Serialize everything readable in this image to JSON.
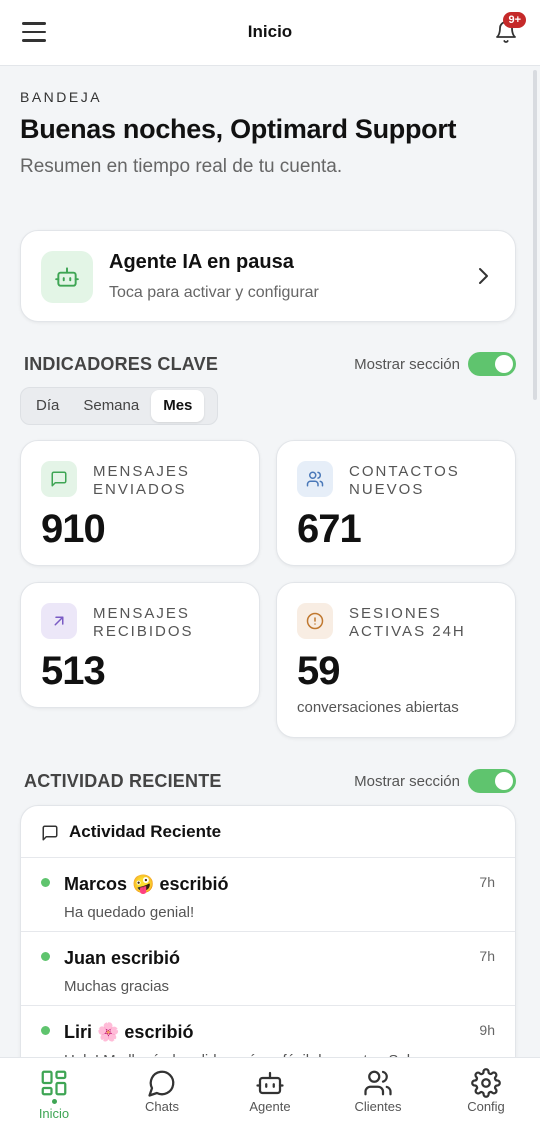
{
  "header": {
    "title": "Inicio",
    "notification_badge": "9+"
  },
  "intro": {
    "eyebrow": "BANDEJA",
    "greeting": "Buenas noches, Optimard Support",
    "subtitle": "Resumen en tiempo real de tu cuenta."
  },
  "agent_card": {
    "title": "Agente IA en pausa",
    "subtitle": "Toca para activar y configurar"
  },
  "kpi_section": {
    "title": "INDICADORES CLAVE",
    "toggle_label": "Mostrar sección",
    "toggle_on": true,
    "periods": [
      "Día",
      "Semana",
      "Mes"
    ],
    "selected_period": "Mes",
    "cards": [
      {
        "label": "MENSAJES ENVIADOS",
        "value": "910",
        "icon": "message-icon",
        "color": "#e4f4e7"
      },
      {
        "label": "CONTACTOS NUEVOS",
        "value": "671",
        "icon": "users-icon",
        "color": "#e6eef8"
      },
      {
        "label": "MENSAJES RECIBIDOS",
        "value": "513",
        "icon": "arrow-up-right-icon",
        "color": "#ece7f8"
      },
      {
        "label": "SESIONES ACTIVAS 24H",
        "value": "59",
        "note": "conversaciones abiertas",
        "icon": "alert-circle-icon",
        "color": "#f8ede3"
      }
    ]
  },
  "activity_section": {
    "title": "ACTIVIDAD RECIENTE",
    "toggle_label": "Mostrar sección",
    "toggle_on": true,
    "card_title": "Actividad Reciente",
    "items": [
      {
        "title": "Marcos 🤪 escribió",
        "message": "Ha quedado genial!",
        "time": "7h"
      },
      {
        "title": "Juan escribió",
        "message": "Muchas gracias",
        "time": "7h"
      },
      {
        "title": "Liri 🌸 escribió",
        "message": "Hola! Me llegó el pedido y súper fácil de montar. Solo un",
        "time": "9h"
      }
    ]
  },
  "bottom_nav": {
    "items": [
      {
        "label": "Inicio",
        "icon": "grid-icon",
        "active": true
      },
      {
        "label": "Chats",
        "icon": "chat-bubble-icon",
        "active": false
      },
      {
        "label": "Agente",
        "icon": "robot-icon",
        "active": false
      },
      {
        "label": "Clientes",
        "icon": "users-icon",
        "active": false
      },
      {
        "label": "Config",
        "icon": "gear-icon",
        "active": false
      }
    ]
  },
  "colors": {
    "accent_green": "#5fc46e",
    "badge_red": "#c52a2a",
    "background": "#f3f5f7"
  }
}
